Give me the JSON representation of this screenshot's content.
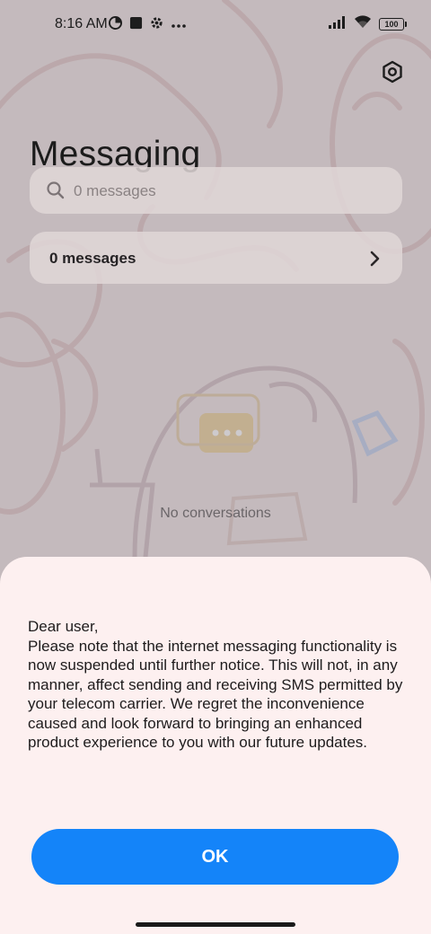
{
  "status_bar": {
    "time": "8:16 AM",
    "battery": "100",
    "icons_left": [
      "data-saver-icon",
      "app-square-icon",
      "gear-small-icon",
      "more-dots-icon"
    ],
    "icons_right": [
      "signal-icon",
      "wifi-icon",
      "battery-icon"
    ]
  },
  "header": {
    "title": "Messaging",
    "settings_icon": "hexagon-settings-icon"
  },
  "search": {
    "placeholder": "0 messages",
    "icon": "search-icon"
  },
  "messages_row": {
    "label": "0 messages",
    "icon": "chevron-right-icon"
  },
  "empty_state": {
    "text": "No conversations"
  },
  "dialog": {
    "message": "Dear user,\nPlease note that the internet messaging functionality is now suspended until further notice. This will not, in any manner, affect sending and receiving SMS permitted by your telecom carrier. We regret the inconvenience caused and look forward to bringing an enhanced product experience to you with our future updates.",
    "ok_label": "OK"
  },
  "colors": {
    "accent": "#1484f9",
    "sheet_bg": "#fdf0f0",
    "background": "#f3e9e8"
  }
}
